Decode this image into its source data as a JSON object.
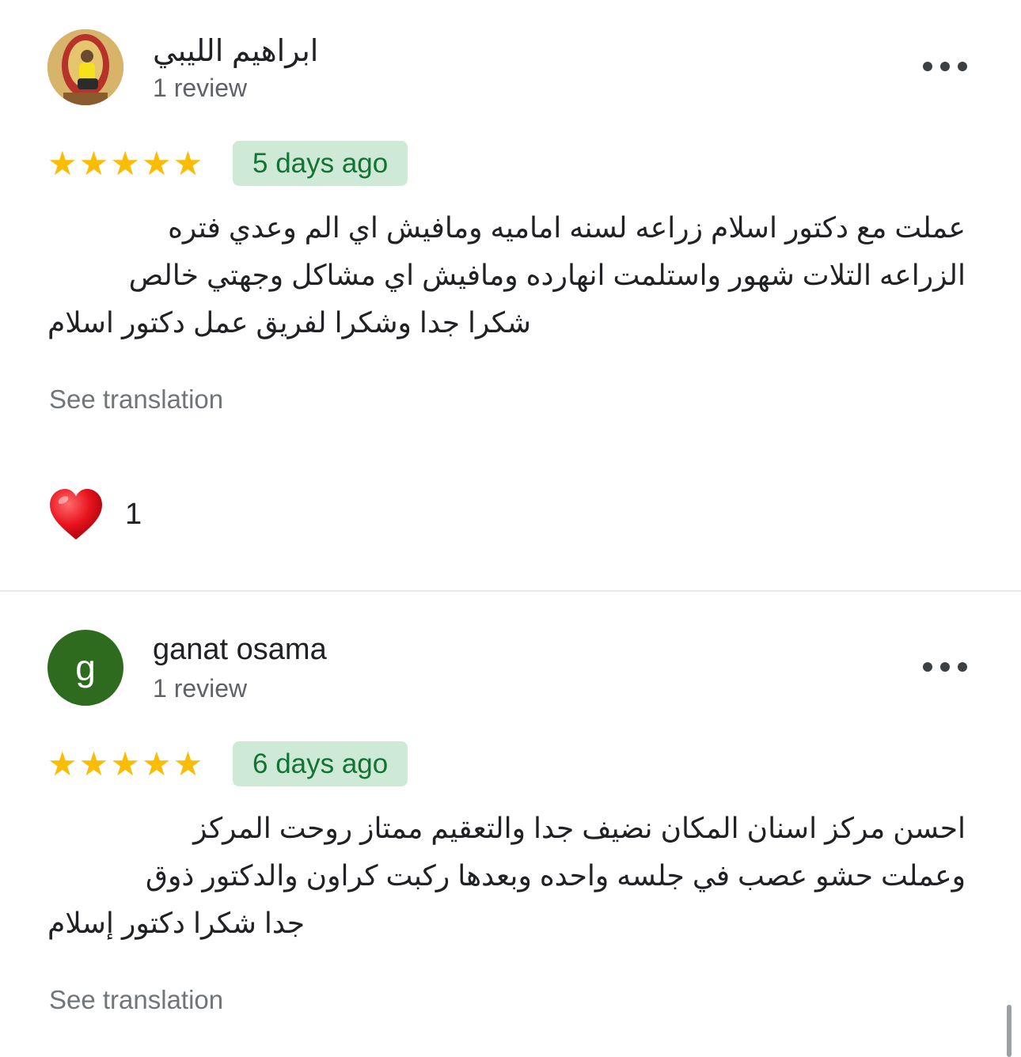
{
  "reviews": [
    {
      "author": "ابراهيم الليبي",
      "meta": "1 review",
      "avatar": "photo",
      "rating": 5,
      "date": "5 days ago",
      "text_lines": [
        "عملت مع دكتور اسلام زراعه لسنه اماميه ومافيش اي الم وعدي فتره",
        "الزراعه التلات شهور واستلمت انهارده ومافيش اي مشاكل وجهتي خالص",
        "شكرا جدا وشكرا لفريق عمل دكتور اسلام"
      ],
      "see_translation": "See translation",
      "reaction": {
        "icon": "heart-icon",
        "count": "1"
      }
    },
    {
      "author": "ganat osama",
      "meta": "1 review",
      "avatar_letter": "g",
      "avatar_color": "#2f6b1f",
      "rating": 5,
      "date": "6 days ago",
      "text_lines": [
        "احسن مركز اسنان المكان نضيف جدا والتعقيم ممتاز روحت المركز",
        "وعملت حشو عصب في جلسه واحده وبعدها ركبت كراون والدكتور ذوق",
        "جدا شكرا دكتور إسلام"
      ],
      "see_translation": "See translation"
    }
  ],
  "colors": {
    "star": "#fbbc04",
    "badge_bg": "#ceead6",
    "badge_text": "#137333",
    "meta_text": "#5f6368"
  }
}
